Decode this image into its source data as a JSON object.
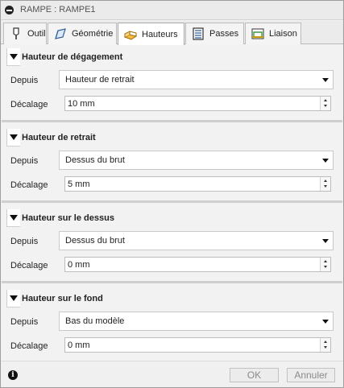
{
  "window": {
    "title": "RAMPE : RAMPE1"
  },
  "tabs": [
    {
      "label": "Outil",
      "icon": "tool-icon"
    },
    {
      "label": "Géométrie",
      "icon": "geometry-icon"
    },
    {
      "label": "Hauteurs",
      "icon": "heights-icon",
      "active": true
    },
    {
      "label": "Passes",
      "icon": "passes-icon"
    },
    {
      "label": "Liaison",
      "icon": "linking-icon"
    }
  ],
  "sections": [
    {
      "title": "Hauteur de dégagement",
      "from_label": "Depuis",
      "from_value": "Hauteur de retrait",
      "offset_label": "Décalage",
      "offset_value": "10 mm"
    },
    {
      "title": "Hauteur de retrait",
      "from_label": "Depuis",
      "from_value": "Dessus du brut",
      "offset_label": "Décalage",
      "offset_value": "5 mm"
    },
    {
      "title": "Hauteur sur le dessus",
      "from_label": "Depuis",
      "from_value": "Dessus du brut",
      "offset_label": "Décalage",
      "offset_value": "0 mm"
    },
    {
      "title": "Hauteur sur le fond",
      "from_label": "Depuis",
      "from_value": "Bas du modèle",
      "offset_label": "Décalage",
      "offset_value": "0 mm"
    }
  ],
  "footer": {
    "ok_label": "OK",
    "cancel_label": "Annuler"
  },
  "colors": {
    "tab_active_bg": "#ffffff",
    "panel_bg": "#f2f2f2",
    "separator": "#cfcfcf",
    "disabled_text": "#8a8a8a"
  }
}
